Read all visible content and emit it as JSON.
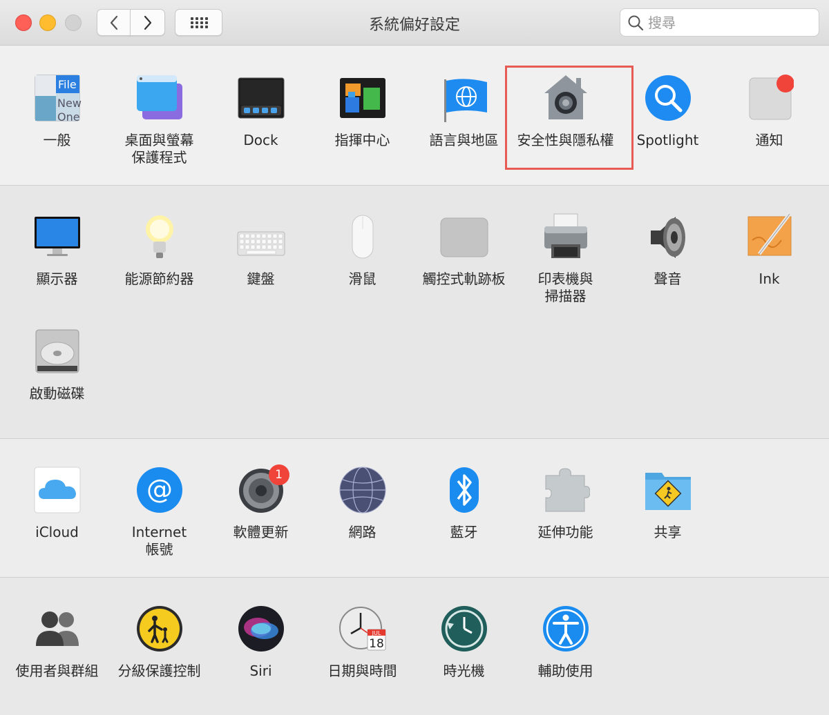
{
  "window": {
    "title": "系統偏好設定",
    "search_placeholder": "搜尋"
  },
  "sections": [
    {
      "items": [
        {
          "label": "一般",
          "icon": "general-icon"
        },
        {
          "label": "桌面與螢幕\n保護程式",
          "icon": "desktop-screensaver-icon"
        },
        {
          "label": "Dock",
          "icon": "dock-icon"
        },
        {
          "label": "指揮中心",
          "icon": "mission-control-icon"
        },
        {
          "label": "語言與地區",
          "icon": "language-region-icon"
        },
        {
          "label": "安全性與隱私權",
          "icon": "security-privacy-icon",
          "highlighted": true
        },
        {
          "label": "Spotlight",
          "icon": "spotlight-icon"
        },
        {
          "label": "通知",
          "icon": "notifications-icon"
        }
      ]
    },
    {
      "items": [
        {
          "label": "顯示器",
          "icon": "displays-icon"
        },
        {
          "label": "能源節約器",
          "icon": "energy-saver-icon"
        },
        {
          "label": "鍵盤",
          "icon": "keyboard-icon"
        },
        {
          "label": "滑鼠",
          "icon": "mouse-icon"
        },
        {
          "label": "觸控式軌跡板",
          "icon": "trackpad-icon"
        },
        {
          "label": "印表機與\n掃描器",
          "icon": "printers-scanners-icon"
        },
        {
          "label": "聲音",
          "icon": "sound-icon"
        },
        {
          "label": "Ink",
          "icon": "ink-icon"
        },
        {
          "label": "啟動磁碟",
          "icon": "startup-disk-icon"
        }
      ]
    },
    {
      "items": [
        {
          "label": "iCloud",
          "icon": "icloud-icon"
        },
        {
          "label": "Internet\n帳號",
          "icon": "internet-accounts-icon"
        },
        {
          "label": "軟體更新",
          "icon": "software-update-icon",
          "badge": "1"
        },
        {
          "label": "網路",
          "icon": "network-icon"
        },
        {
          "label": "藍牙",
          "icon": "bluetooth-icon"
        },
        {
          "label": "延伸功能",
          "icon": "extensions-icon"
        },
        {
          "label": "共享",
          "icon": "sharing-icon"
        }
      ]
    },
    {
      "items": [
        {
          "label": "使用者與群組",
          "icon": "users-groups-icon"
        },
        {
          "label": "分級保護控制",
          "icon": "parental-controls-icon"
        },
        {
          "label": "Siri",
          "icon": "siri-icon"
        },
        {
          "label": "日期與時間",
          "icon": "date-time-icon",
          "calendar_month": "JUL",
          "calendar_day": "18"
        },
        {
          "label": "時光機",
          "icon": "time-machine-icon"
        },
        {
          "label": "輔助使用",
          "icon": "accessibility-icon"
        }
      ]
    }
  ],
  "general_icon_text": [
    "File",
    "New",
    "One"
  ],
  "colors": {
    "highlight": "#e85b55",
    "badge": "#f0443a",
    "accent_blue": "#1a8cf0"
  }
}
